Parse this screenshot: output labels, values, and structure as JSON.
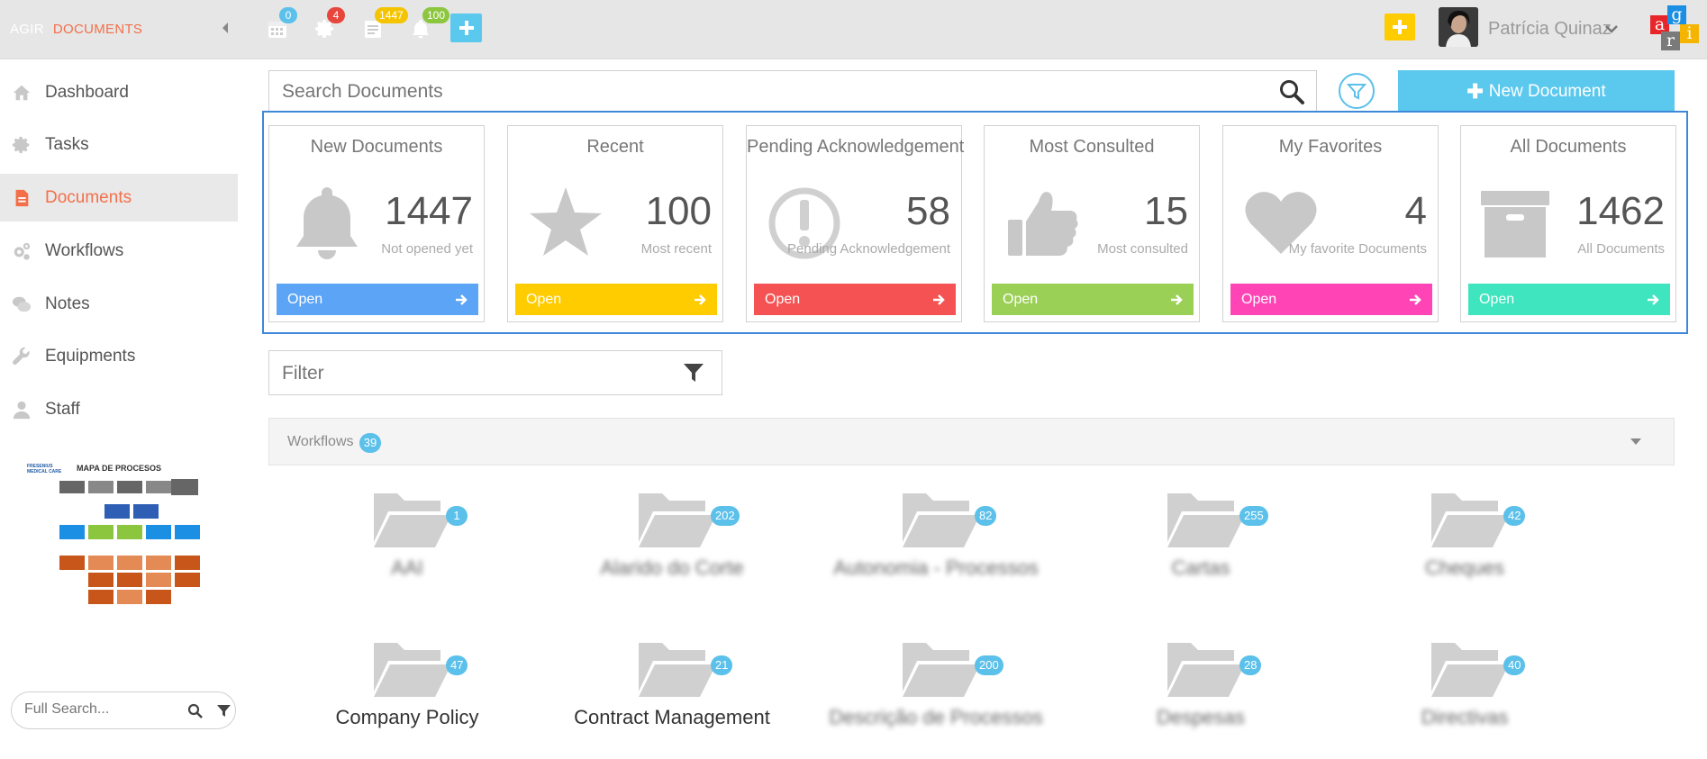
{
  "brand": {
    "left": "AGIR",
    "right": "DOCUMENTS"
  },
  "topbar": {
    "calendar_badge": "0",
    "tasks_badge": "4",
    "documents_badge": "1447",
    "notifications_badge": "100",
    "user_name": "Patrícia Quinaz",
    "logo_letters": [
      "a",
      "g",
      "r",
      "i"
    ]
  },
  "colors": {
    "accent_orange": "#f36f4a",
    "badge_blue": "#5bc0ea",
    "badge_red": "#e8453c",
    "badge_yellow": "#f5c400",
    "badge_green": "#8cc63e",
    "plus_yellow": "#ffcc00",
    "frame_blue": "#3f88d8"
  },
  "sidebar": {
    "items": [
      {
        "label": "Dashboard",
        "icon": "home-icon"
      },
      {
        "label": "Tasks",
        "icon": "gear-icon"
      },
      {
        "label": "Documents",
        "icon": "document-icon",
        "active": true
      },
      {
        "label": "Workflows",
        "icon": "gears-icon"
      },
      {
        "label": "Notes",
        "icon": "comments-icon"
      },
      {
        "label": "Equipments",
        "icon": "wrench-icon"
      },
      {
        "label": "Staff",
        "icon": "user-icon"
      }
    ],
    "process_map": {
      "brand": "FRESENIUS MEDICAL CARE",
      "title": "MAPA DE PROCESOS"
    },
    "full_search_placeholder": "Full Search..."
  },
  "main": {
    "search_placeholder": "Search Documents",
    "new_document_label": "New Document",
    "filter_placeholder": "Filter",
    "cards": [
      {
        "title": "New Documents",
        "count": "1447",
        "subtitle": "Not opened yet",
        "open": "Open",
        "color": "#5ba4f6",
        "icon": "bell-icon"
      },
      {
        "title": "Recent",
        "count": "100",
        "subtitle": "Most recent",
        "open": "Open",
        "color": "#ffcc00",
        "icon": "star-icon"
      },
      {
        "title": "Pending Acknowledgement",
        "count": "58",
        "subtitle": "Pending Acknowledgement",
        "open": "Open",
        "color": "#f55353",
        "icon": "exclamation-circle-icon"
      },
      {
        "title": "Most Consulted",
        "count": "15",
        "subtitle": "Most consulted",
        "open": "Open",
        "color": "#9bd056",
        "icon": "thumbs-up-icon"
      },
      {
        "title": "My Favorites",
        "count": "4",
        "subtitle": "My favorite Documents",
        "open": "Open",
        "color": "#ff45b5",
        "icon": "heart-icon"
      },
      {
        "title": "All Documents",
        "count": "1462",
        "subtitle": "All Documents",
        "open": "Open",
        "color": "#3ee5be",
        "icon": "archive-icon"
      }
    ],
    "workflows": {
      "label": "Workflows",
      "count": "39"
    },
    "folders": [
      {
        "name": "AAI",
        "count": "1",
        "blurred": true
      },
      {
        "name": "Alarido do Corte",
        "count": "202",
        "blurred": true
      },
      {
        "name": "Autonomia - Processos",
        "count": "82",
        "blurred": true
      },
      {
        "name": "Cartas",
        "count": "255",
        "blurred": true
      },
      {
        "name": "Cheques",
        "count": "42",
        "blurred": true
      },
      {
        "name": "Company Policy",
        "count": "47",
        "blurred": false
      },
      {
        "name": "Contract Management",
        "count": "21",
        "blurred": false
      },
      {
        "name": "Descrição de Processos",
        "count": "200",
        "blurred": true
      },
      {
        "name": "Despesas",
        "count": "28",
        "blurred": true
      },
      {
        "name": "Directivas",
        "count": "40",
        "blurred": true
      }
    ]
  }
}
